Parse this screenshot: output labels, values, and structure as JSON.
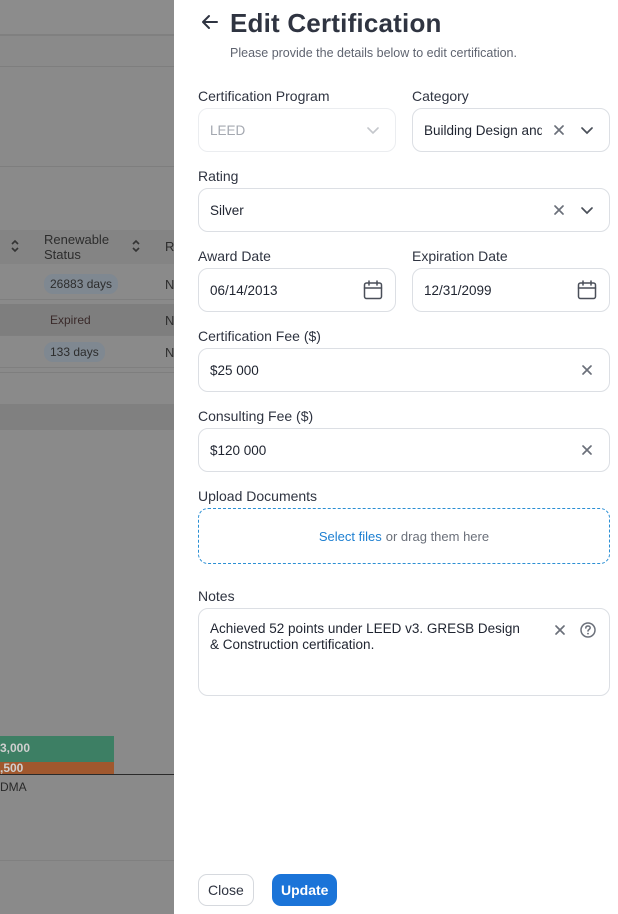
{
  "background": {
    "table": {
      "header": {
        "renewable_status": "Renewable\nStatus",
        "next_col": "Re"
      },
      "rows": [
        {
          "status": "26883 days",
          "status_style": "blue",
          "next": "N"
        },
        {
          "status": "Expired",
          "status_style": "plain",
          "next": "N"
        },
        {
          "status": "133 days",
          "status_style": "blue",
          "next": "N"
        }
      ]
    },
    "chart": {
      "bar_top_label": "3,000",
      "bar_bottom_label": ",500",
      "axis_label": "DMA"
    }
  },
  "drawer": {
    "title": "Edit Certification",
    "subtitle": "Please provide the details below to edit certification.",
    "fields": {
      "program": {
        "label": "Certification Program",
        "value": "LEED"
      },
      "category": {
        "label": "Category",
        "value": "Building Design and Construction"
      },
      "rating": {
        "label": "Rating",
        "value": "Silver"
      },
      "award_date": {
        "label": "Award Date",
        "value": "06/14/2013"
      },
      "expiration_date": {
        "label": "Expiration Date",
        "value": "12/31/2099"
      },
      "cert_fee": {
        "label": "Certification Fee ($)",
        "value": "$25 000"
      },
      "consult_fee": {
        "label": "Consulting Fee ($)",
        "value": "$120 000"
      },
      "upload": {
        "label": "Upload Documents",
        "link": "Select files",
        "hint": "or drag them here"
      },
      "notes": {
        "label": "Notes",
        "value": "Achieved 52 points under LEED v3. GRESB Design & Construction certification."
      }
    },
    "buttons": {
      "close": "Close",
      "update": "Update"
    }
  },
  "colors": {
    "accent": "#1b74d8",
    "link": "#1d7fd1",
    "text": "#2f3441"
  },
  "icons": [
    "arrow-left-icon",
    "chevron-down-icon",
    "close-icon",
    "calendar-icon",
    "help-icon"
  ]
}
